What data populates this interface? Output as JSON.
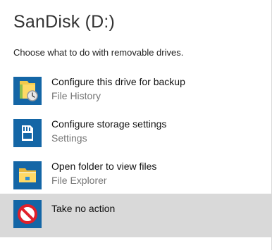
{
  "dialog": {
    "title": "SanDisk (D:)",
    "prompt": "Choose what to do with removable drives."
  },
  "options": [
    {
      "title": "Configure this drive for backup",
      "subtitle": "File History",
      "icon": "file-history-icon"
    },
    {
      "title": "Configure storage settings",
      "subtitle": "Settings",
      "icon": "sd-card-icon"
    },
    {
      "title": "Open folder to view files",
      "subtitle": "File Explorer",
      "icon": "folder-icon"
    },
    {
      "title": "Take no action",
      "subtitle": "",
      "icon": "no-action-icon",
      "selected": true
    }
  ],
  "colors": {
    "icon_tile": "#1466a6",
    "selected_row": "#d9d9d9",
    "no_action_red": "#e0202a"
  }
}
